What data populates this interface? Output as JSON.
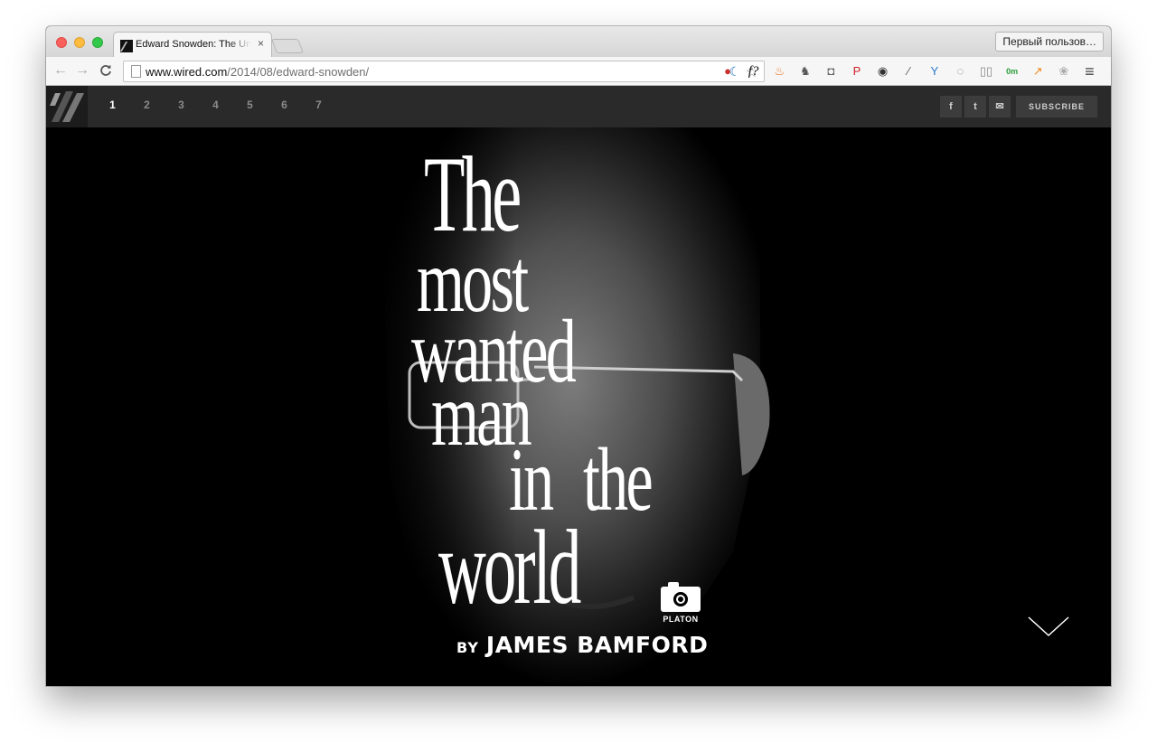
{
  "browser": {
    "tab_title": "Edward Snowden: The Untold Story",
    "tab_close": "×",
    "profile_button": "Первый пользов…",
    "url_host": "www.wired.com",
    "url_path": "/2014/08/edward-snowden/",
    "nav_back": "←",
    "nav_forward": "→",
    "nav_reload": "C",
    "star": "☆",
    "extensions": [
      {
        "name": "adblock-icon",
        "glyph": "●",
        "color": "#c9302c"
      },
      {
        "name": "fquery-icon",
        "glyph": "f?",
        "color": "#111111"
      },
      {
        "name": "flame-icon",
        "glyph": "♨",
        "color": "#e8731c"
      },
      {
        "name": "evernote-icon",
        "glyph": "♞",
        "color": "#555555"
      },
      {
        "name": "pocket-icon",
        "glyph": "◘",
        "color": "#666666"
      },
      {
        "name": "pinterest-icon",
        "glyph": "P",
        "color": "#cb2027"
      },
      {
        "name": "lens-icon",
        "glyph": "◉",
        "color": "#333333"
      },
      {
        "name": "eyedropper-icon",
        "glyph": "⁄",
        "color": "#555555"
      },
      {
        "name": "y-icon",
        "glyph": "Y",
        "color": "#2a7ac9"
      },
      {
        "name": "refresh-circle-icon",
        "glyph": "◌",
        "color": "#777777"
      },
      {
        "name": "reader-icon",
        "glyph": "▯▯",
        "color": "#888888"
      },
      {
        "name": "timer-icon",
        "glyph": "0m",
        "color": "#2a9d3a"
      },
      {
        "name": "chart-icon",
        "glyph": "↗",
        "color": "#ef8a1e"
      },
      {
        "name": "paw-icon",
        "glyph": "❀",
        "color": "#aaaaaa"
      },
      {
        "name": "menu-icon",
        "glyph": "≡",
        "color": "#444444"
      }
    ]
  },
  "site_nav": {
    "pages": [
      "1",
      "2",
      "3",
      "4",
      "5",
      "6",
      "7"
    ],
    "active_page": "1",
    "share": [
      {
        "name": "facebook-icon",
        "glyph": "f"
      },
      {
        "name": "twitter-icon",
        "glyph": "t"
      },
      {
        "name": "email-icon",
        "glyph": "✉"
      }
    ],
    "subscribe_label": "SUBSCRIBE"
  },
  "hero": {
    "headline": {
      "line1": "The",
      "line2": "most",
      "line3": "wanted",
      "line4": "man",
      "line5a": "in",
      "line5b": "the",
      "line6": "world"
    },
    "photo_credit": "PLATON",
    "byline_prefix": "BY",
    "author": "JAMES BAMFORD"
  },
  "colors": {
    "background": "#000000",
    "nav_bar": "#2a2a2a",
    "headline": "#ffffff"
  }
}
